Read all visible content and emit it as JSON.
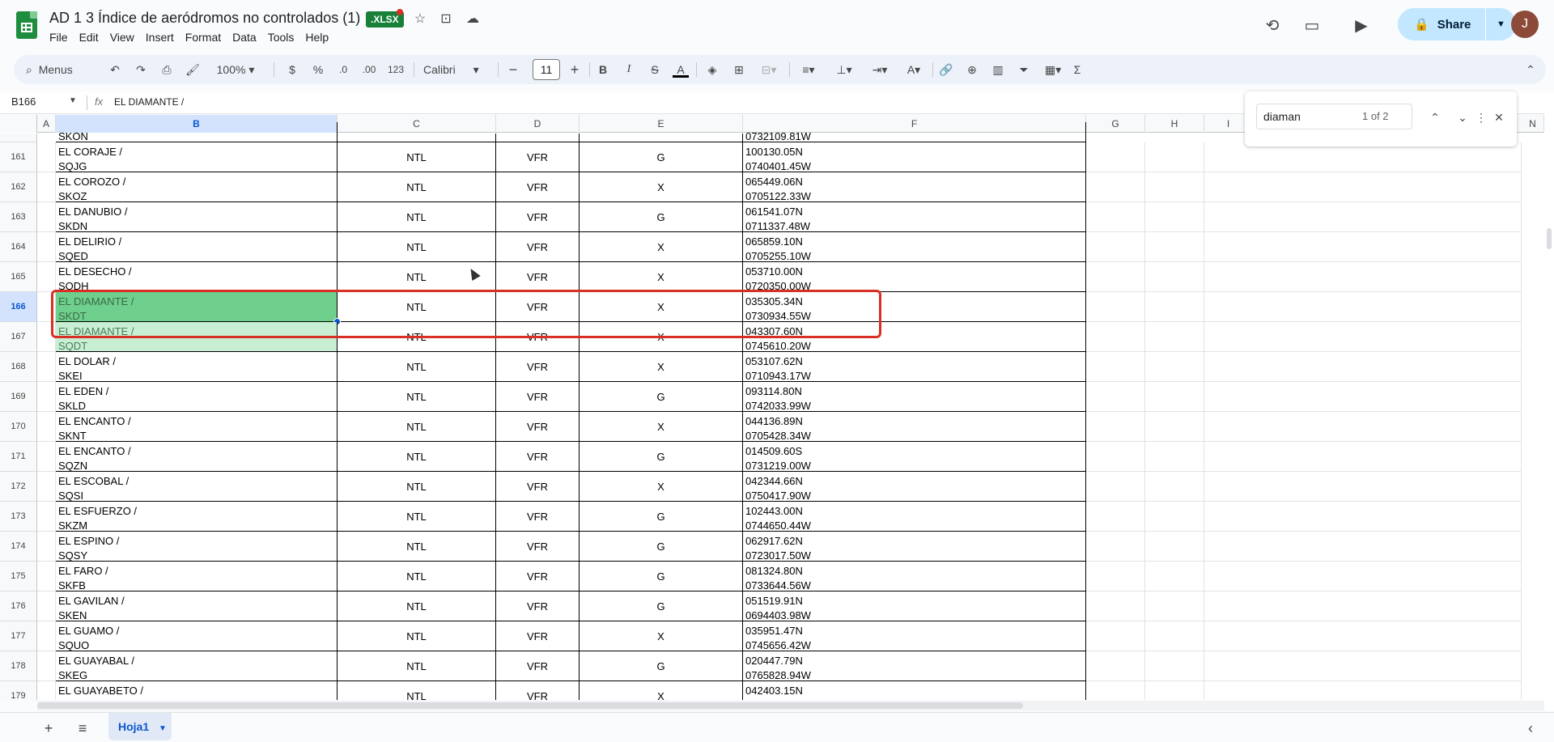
{
  "doc": {
    "title": "AD 1 3 Índice de aeródromos no controlados (1)",
    "badge": ".XLSX"
  },
  "menu": [
    "File",
    "Edit",
    "View",
    "Insert",
    "Format",
    "Data",
    "Tools",
    "Help"
  ],
  "header": {
    "share_label": "Share",
    "avatar_letter": "J"
  },
  "toolbar": {
    "menus_label": "Menus",
    "zoom": "100%",
    "currency": "$",
    "percent": "%",
    "dec_decrease": ".0",
    "dec_increase": ".00",
    "number_format": "123",
    "font": "Calibri",
    "font_size": "11"
  },
  "formula_bar": {
    "cell_ref": "B166",
    "fx": "fx",
    "content": "EL DIAMANTE /"
  },
  "find": {
    "query": "diaman",
    "count": "1 of 2"
  },
  "columns": [
    "A",
    "B",
    "C",
    "D",
    "E",
    "F",
    "G",
    "H",
    "I",
    "N"
  ],
  "rows": [
    {
      "num": "161",
      "name1": "EL CORAJE /",
      "name2": "SQJG",
      "c": "NTL",
      "d": "VFR",
      "e": "G",
      "lat": "100130.05N",
      "lon": "0740401.45W"
    },
    {
      "num": "162",
      "name1": "EL COROZO /",
      "name2": "SKOZ",
      "c": "NTL",
      "d": "VFR",
      "e": "X",
      "lat": "065449.06N",
      "lon": "0705122.33W"
    },
    {
      "num": "163",
      "name1": "EL DANUBIO /",
      "name2": "SKDN",
      "c": "NTL",
      "d": "VFR",
      "e": "G",
      "lat": "061541.07N",
      "lon": "0711337.48W"
    },
    {
      "num": "164",
      "name1": "EL DELIRIO /",
      "name2": "SQED",
      "c": "NTL",
      "d": "VFR",
      "e": "X",
      "lat": "065859.10N",
      "lon": "0705255.10W"
    },
    {
      "num": "165",
      "name1": "EL DESECHO /",
      "name2": "SQDH",
      "c": "NTL",
      "d": "VFR",
      "e": "X",
      "lat": "053710.00N",
      "lon": "0720350.00W"
    },
    {
      "num": "166",
      "name1": "EL DIAMANTE /",
      "name2": "SKDT",
      "c": "NTL",
      "d": "VFR",
      "e": "X",
      "lat": "035305.34N",
      "lon": "0730934.55W"
    },
    {
      "num": "167",
      "name1": "EL DIAMANTE /",
      "name2": "SQDT",
      "c": "NTL",
      "d": "VFR",
      "e": "X",
      "lat": "043307.60N",
      "lon": "0745610.20W"
    },
    {
      "num": "168",
      "name1": "EL DOLAR /",
      "name2": "SKEI",
      "c": "NTL",
      "d": "VFR",
      "e": "X",
      "lat": "053107.62N",
      "lon": "0710943.17W"
    },
    {
      "num": "169",
      "name1": "EL EDEN /",
      "name2": "SKLD",
      "c": "NTL",
      "d": "VFR",
      "e": "G",
      "lat": "093114.80N",
      "lon": "0742033.99W"
    },
    {
      "num": "170",
      "name1": "EL ENCANTO /",
      "name2": "SKNT",
      "c": "NTL",
      "d": "VFR",
      "e": "X",
      "lat": "044136.89N",
      "lon": "0705428.34W"
    },
    {
      "num": "171",
      "name1": "EL ENCANTO /",
      "name2": "SQZN",
      "c": "NTL",
      "d": "VFR",
      "e": "G",
      "lat": "014509.60S",
      "lon": "0731219.00W"
    },
    {
      "num": "172",
      "name1": "EL ESCOBAL /",
      "name2": "SQSI",
      "c": "NTL",
      "d": "VFR",
      "e": "X",
      "lat": "042344.66N",
      "lon": "0750417.90W"
    },
    {
      "num": "173",
      "name1": "EL ESFUERZO /",
      "name2": "SKZM",
      "c": "NTL",
      "d": "VFR",
      "e": "G",
      "lat": "102443.00N",
      "lon": "0744650.44W"
    },
    {
      "num": "174",
      "name1": "EL ESPINO /",
      "name2": "SQSY",
      "c": "NTL",
      "d": "VFR",
      "e": "G",
      "lat": "062917.62N",
      "lon": "0723017.50W"
    },
    {
      "num": "175",
      "name1": "EL FARO /",
      "name2": "SKFB",
      "c": "NTL",
      "d": "VFR",
      "e": "G",
      "lat": "081324.80N",
      "lon": "0733644.56W"
    },
    {
      "num": "176",
      "name1": "EL GAVILAN /",
      "name2": "SKEN",
      "c": "NTL",
      "d": "VFR",
      "e": "G",
      "lat": "051519.91N",
      "lon": "0694403.98W"
    },
    {
      "num": "177",
      "name1": "EL GUAMO /",
      "name2": "SQUO",
      "c": "NTL",
      "d": "VFR",
      "e": "X",
      "lat": "035951.47N",
      "lon": "0745656.42W"
    },
    {
      "num": "178",
      "name1": "EL GUAYABAL /",
      "name2": "SKEG",
      "c": "NTL",
      "d": "VFR",
      "e": "G",
      "lat": "020447.79N",
      "lon": "0765828.94W"
    },
    {
      "num": "179",
      "name1": "EL GUAYABETO /",
      "name2": "",
      "c": "NTL",
      "d": "VFR",
      "e": "X",
      "lat": "042403.15N",
      "lon": ""
    }
  ],
  "partial_top": {
    "name2": "SKON",
    "lon": "0732109.81W"
  },
  "sheet": {
    "tab": "Hoja1"
  }
}
